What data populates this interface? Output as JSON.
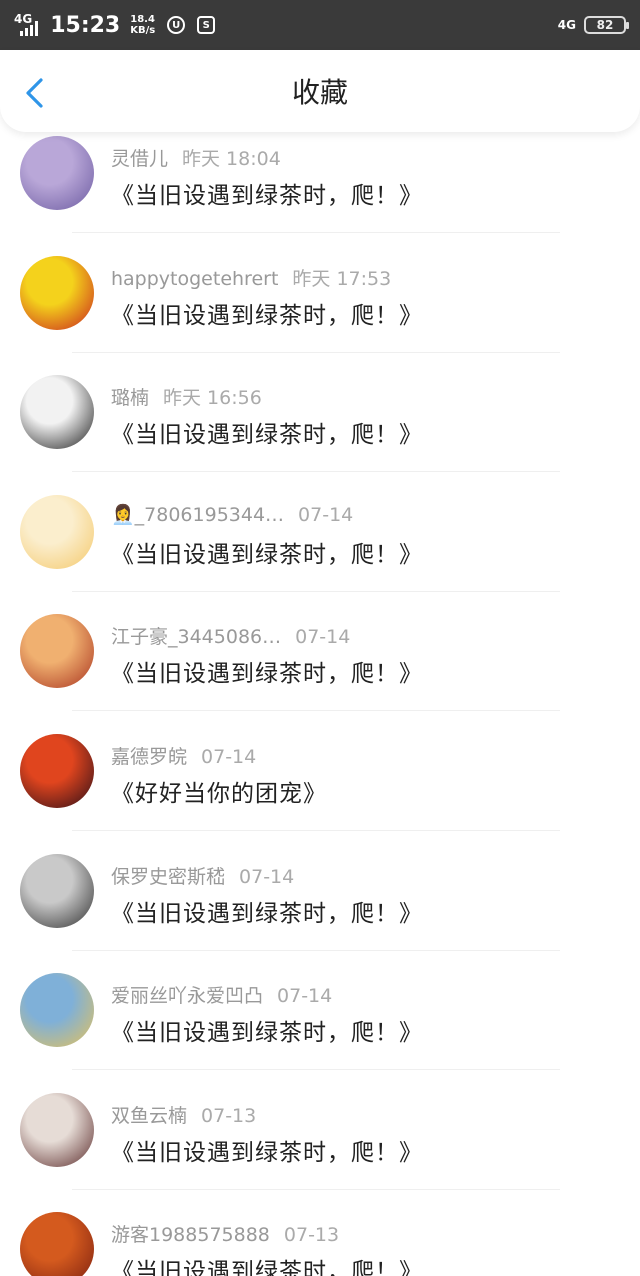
{
  "status_bar": {
    "network_left": "4G",
    "time": "15:23",
    "speed_value": "18.4",
    "speed_unit": "KB/s",
    "network_right": "4G",
    "battery": "82"
  },
  "header": {
    "title": "收藏"
  },
  "items": [
    {
      "user": "灵借儿",
      "time": "昨天 18:04",
      "title": "《当旧设遇到绿茶时，爬！》",
      "avatar_color": "#b9a7d8",
      "avatar_color2": "#6b5aa0"
    },
    {
      "user": "happytogetehrert",
      "time": "昨天 17:53",
      "title": "《当旧设遇到绿茶时，爬！》",
      "avatar_color": "#f4d21c",
      "avatar_color2": "#c8201e"
    },
    {
      "user": "璐楠",
      "time": "昨天 16:56",
      "title": "《当旧设遇到绿茶时，爬！》",
      "avatar_color": "#f2f2f2",
      "avatar_color2": "#1c1c1c"
    },
    {
      "user": "👩‍💼_7806195344…",
      "time": "07-14",
      "title": "《当旧设遇到绿茶时，爬！》",
      "avatar_color": "#fbeecd",
      "avatar_color2": "#f4c86a"
    },
    {
      "user": "江子豪_3445086…",
      "time": "07-14",
      "title": "《当旧设遇到绿茶时，爬！》",
      "avatar_color": "#f0b070",
      "avatar_color2": "#a8321e"
    },
    {
      "user": "嘉德罗皖",
      "time": "07-14",
      "title": "《好好当你的团宠》",
      "avatar_color": "#e0451e",
      "avatar_color2": "#2a0d18"
    },
    {
      "user": "保罗史密斯嵇",
      "time": "07-14",
      "title": "《当旧设遇到绿茶时，爬！》",
      "avatar_color": "#c9c9c9",
      "avatar_color2": "#2e2e2e"
    },
    {
      "user": "爱丽丝吖永爱凹凸",
      "time": "07-14",
      "title": "《当旧设遇到绿茶时，爬！》",
      "avatar_color": "#7fb0d8",
      "avatar_color2": "#e6c25a"
    },
    {
      "user": "双鱼云楠",
      "time": "07-13",
      "title": "《当旧设遇到绿茶时，爬！》",
      "avatar_color": "#e6dcd6",
      "avatar_color2": "#5a2a2a"
    },
    {
      "user": "游客1988575888",
      "time": "07-13",
      "title": "《当旧设遇到绿茶时，爬！》",
      "avatar_color": "#d45a1e",
      "avatar_color2": "#7a1e10"
    }
  ]
}
